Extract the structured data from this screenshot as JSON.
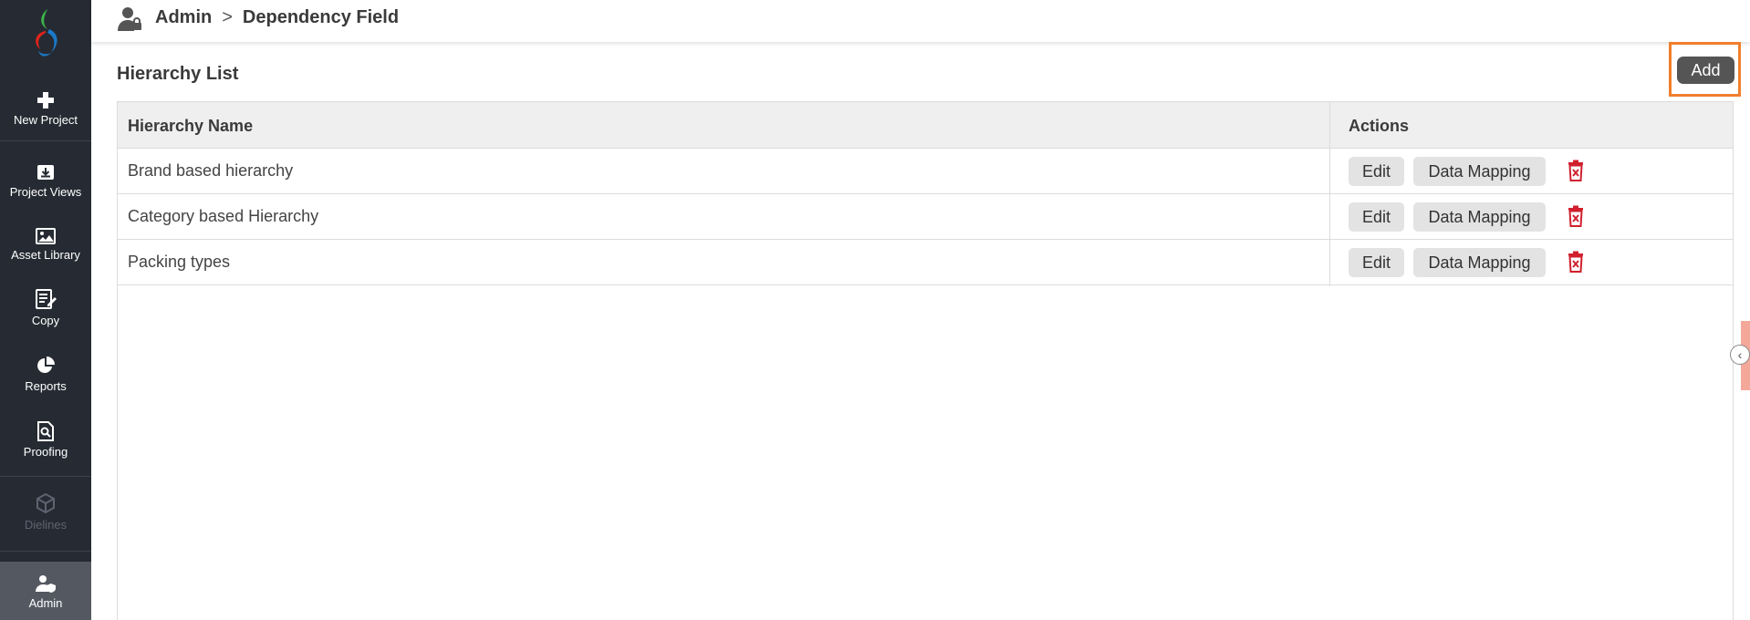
{
  "breadcrumb": {
    "section": "Admin",
    "separator": ">",
    "page": "Dependency Field"
  },
  "sidebar": {
    "items": [
      {
        "label": "New Project",
        "icon": "plus-icon"
      },
      {
        "label": "Project Views",
        "icon": "download-box-icon"
      },
      {
        "label": "Asset Library",
        "icon": "image-icon"
      },
      {
        "label": "Copy",
        "icon": "edit-document-icon"
      },
      {
        "label": "Reports",
        "icon": "pie-chart-icon"
      },
      {
        "label": "Proofing",
        "icon": "search-document-icon"
      },
      {
        "label": "Dielines",
        "icon": "box-icon",
        "disabled": true
      },
      {
        "label": "Admin",
        "icon": "user-shield-icon",
        "active": true
      }
    ]
  },
  "main": {
    "title": "Hierarchy List",
    "add_label": "Add",
    "table": {
      "headers": [
        "Hierarchy Name",
        "Actions"
      ],
      "rows": [
        {
          "name": "Brand based hierarchy"
        },
        {
          "name": "Category based Hierarchy"
        },
        {
          "name": "Packing types"
        }
      ],
      "edit_label": "Edit",
      "mapping_label": "Data Mapping"
    }
  },
  "colors": {
    "sidebar": "#262b33",
    "accent_highlight": "#f07f2b",
    "delete": "#d0202e",
    "add_button": "#555555"
  }
}
